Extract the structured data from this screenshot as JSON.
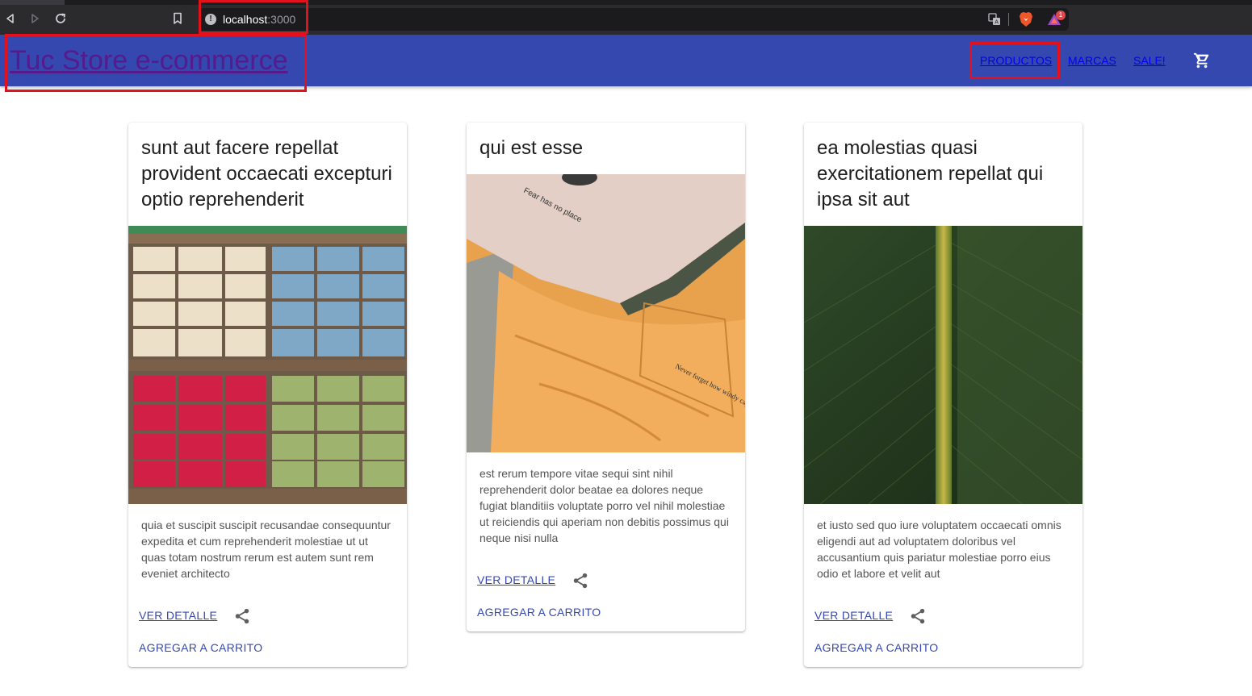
{
  "browser": {
    "address_host": "localhost",
    "address_port": ":3000",
    "rewards_badge": "1"
  },
  "appbar": {
    "brand": "Tuc Store e-commerce",
    "nav": [
      "PRODUCTOS",
      "MARCAS",
      "SALE!"
    ],
    "cart_icon": "shopping-cart-icon"
  },
  "cards": [
    {
      "title": "sunt aut facere repellat provident occaecati excepturi optio reprehenderit",
      "description": "quia et suscipit suscipit recusandae consequuntur expedita et cum reprehenderit molestiae ut ut quas totam nostrum rerum est autem sunt rem eveniet architecto",
      "detail_label": "VER DETALLE",
      "cart_label": "AGREGAR A CARRITO",
      "image": "soap-bars-photo"
    },
    {
      "title": "qui est esse",
      "description": "est rerum tempore vitae sequi sint nihil reprehenderit dolor beatae ea dolores neque fugiat blanditiis voluptate porro vel nihil molestiae ut reiciendis qui aperiam non debitis possimus qui neque nisi nulla",
      "detail_label": "VER DETALLE",
      "cart_label": "AGREGAR A CARRITO",
      "image": "folded-tshirts-photo",
      "shirt_print": "Fear has no place",
      "pocket_print": "Never forget how windy capable you are"
    },
    {
      "title": "ea molestias quasi exercitationem repellat qui ipsa sit aut",
      "description": "et iusto sed quo iure voluptatem occaecati omnis eligendi aut ad voluptatem doloribus vel accusantium quis pariatur molestiae porro eius odio et labore et velit aut",
      "detail_label": "VER DETALLE",
      "cart_label": "AGREGAR A CARRITO",
      "image": "green-leaf-photo"
    }
  ]
}
